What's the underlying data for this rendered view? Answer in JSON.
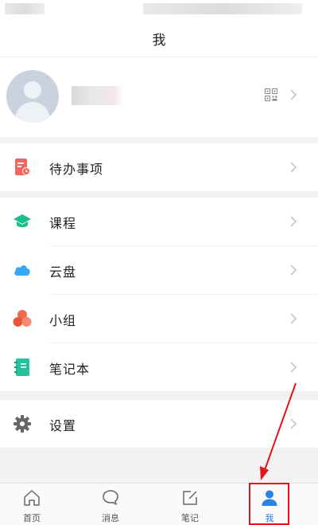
{
  "nav": {
    "title": "我"
  },
  "menu": {
    "todo": "待办事项",
    "course": "课程",
    "cloud": "云盘",
    "group": "小组",
    "notebook": "笔记本",
    "settings": "设置"
  },
  "tabs": [
    {
      "label": "首页",
      "icon": "home-icon"
    },
    {
      "label": "消息",
      "icon": "message-icon"
    },
    {
      "label": "笔记",
      "icon": "note-icon"
    },
    {
      "label": "我",
      "icon": "profile-icon",
      "active": true
    }
  ],
  "colors": {
    "accent": "#2a82e4",
    "todo": "#f2665e",
    "course": "#1cbf8c",
    "cloud": "#38a8ef",
    "group": "#f06b4d",
    "notebook": "#26c29c",
    "settings": "#666666",
    "highlight": "#e4131b"
  }
}
